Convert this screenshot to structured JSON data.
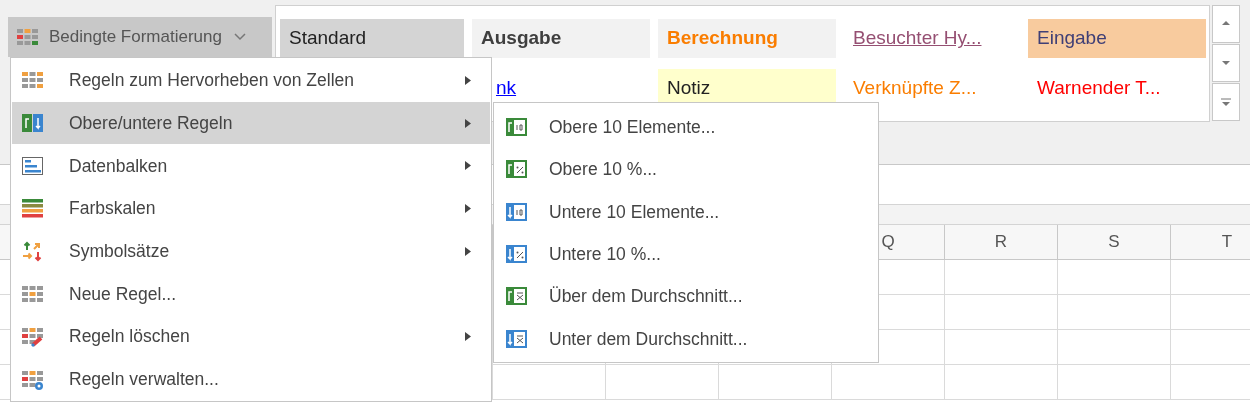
{
  "ribbon": {
    "dropdown": {
      "label": "Bedingte Formatierung",
      "expanded": true
    },
    "styles": [
      [
        {
          "label": "Standard",
          "kind": "standard"
        },
        {
          "label": "Ausgabe",
          "kind": "output"
        },
        {
          "label": "Berechnung",
          "kind": "calculation"
        },
        {
          "label": "Besuchter Hy...",
          "kind": "visited"
        },
        {
          "label": "Eingabe",
          "kind": "input"
        }
      ],
      [
        {
          "label": "nk",
          "kind": "link"
        },
        {
          "label": "Notiz",
          "kind": "note"
        },
        {
          "label": "Verknüpfte Z...",
          "kind": "linked"
        },
        {
          "label": "Warnender T...",
          "kind": "warning"
        }
      ]
    ]
  },
  "menu": {
    "items": [
      {
        "label": "Regeln zum Hervorheben von Zellen",
        "submenu": true,
        "selected": false
      },
      {
        "label": "Obere/untere Regeln",
        "submenu": true,
        "selected": true
      },
      {
        "label": "Datenbalken",
        "submenu": true,
        "selected": false
      },
      {
        "label": "Farbskalen",
        "submenu": true,
        "selected": false
      },
      {
        "label": "Symbolsätze",
        "submenu": true,
        "selected": false
      },
      {
        "label": "Neue Regel...",
        "submenu": false,
        "selected": false
      },
      {
        "label": "Regeln löschen",
        "submenu": true,
        "selected": false
      },
      {
        "label": "Regeln verwalten...",
        "submenu": false,
        "selected": false
      }
    ]
  },
  "submenu": {
    "items": [
      {
        "label": "Obere 10 Elemente..."
      },
      {
        "label": "Obere 10 %..."
      },
      {
        "label": "Untere 10 Elemente..."
      },
      {
        "label": "Untere 10 %..."
      },
      {
        "label": "Über dem Durchschnitt..."
      },
      {
        "label": "Unter dem Durchschnitt..."
      }
    ]
  },
  "sheet": {
    "columns": [
      "Q",
      "R",
      "S",
      "T"
    ]
  }
}
